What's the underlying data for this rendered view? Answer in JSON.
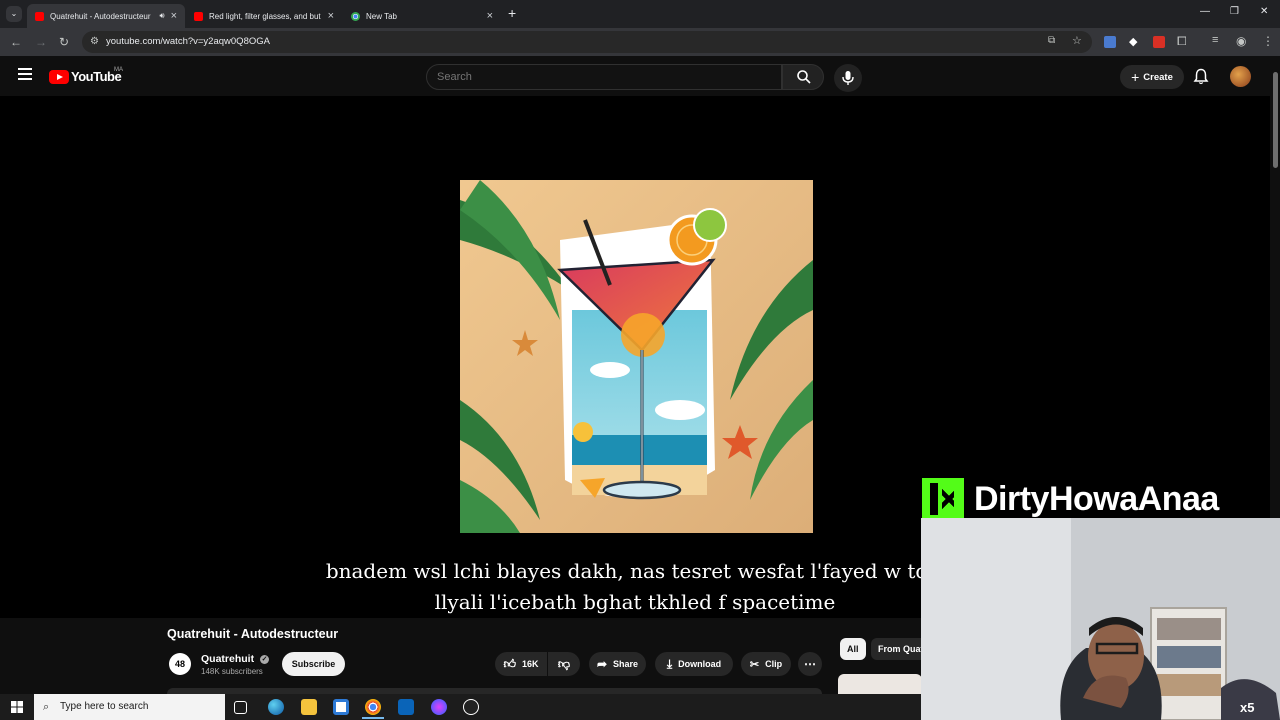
{
  "browser": {
    "tabs": [
      {
        "title": "Quatrehuit - Autodestructeur",
        "active": true,
        "favicon": "youtube-icon",
        "audio": true
      },
      {
        "title": "Red light, filter glasses, and but",
        "active": false,
        "favicon": "youtube-icon"
      },
      {
        "title": "New Tab",
        "active": false,
        "favicon": "chrome-icon"
      }
    ],
    "url": "youtube.com/watch?v=y2aqw0Q8OGA",
    "accent": "#ff0000"
  },
  "youtube": {
    "logo_text": "YouTube",
    "region": "MA",
    "search_placeholder": "Search",
    "create_label": "Create"
  },
  "video": {
    "captions": [
      "bnadem wsl lchi blayes dakh, nas tesret wesfat l'fayed w tdir",
      "llyali l'icebath bghat tkhled f spacetime"
    ],
    "title": "Quatrehuit - Autodestructeur",
    "channel": {
      "name": "Quatrehuit",
      "avatar_text": "48",
      "verified": true,
      "subscribers": "148K subscribers"
    },
    "subscribe_label": "Subscribe",
    "likes": "16K",
    "share_label": "Share",
    "download_label": "Download",
    "clip_label": "Clip"
  },
  "recommendations": {
    "chips": [
      "All",
      "From Quat"
    ]
  },
  "overlay": {
    "streamer": "DirtyHowaAnaa",
    "brand_color": "#53fc18",
    "multiplier": "x5"
  },
  "taskbar": {
    "search_placeholder": "Type here to search"
  }
}
